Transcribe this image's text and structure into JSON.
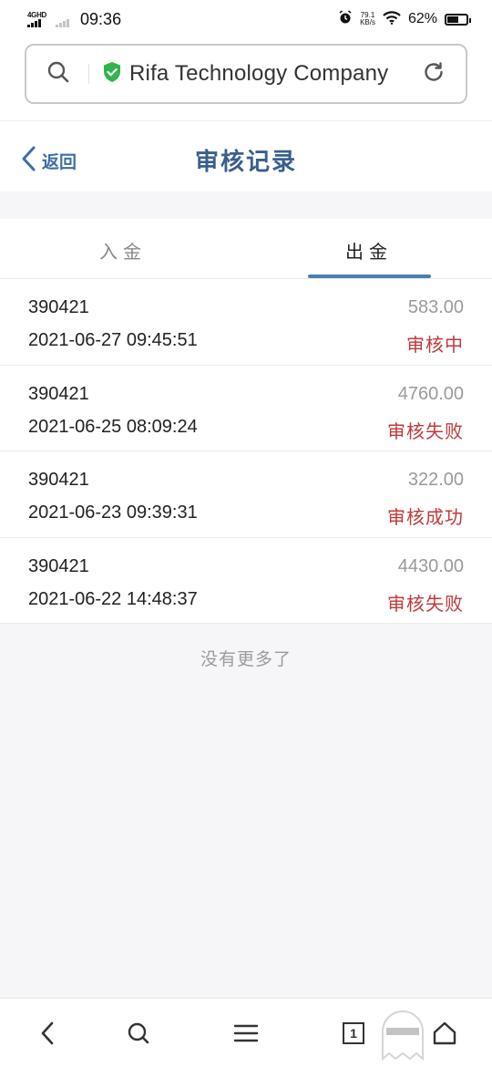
{
  "status_bar": {
    "network": "4GHD",
    "time": "09:36",
    "speed_value": "79.1",
    "speed_unit": "KB/s",
    "battery": "62%",
    "battery_level": 0.62,
    "icons": [
      "alarm-icon",
      "wifi-icon",
      "battery-icon"
    ]
  },
  "browser": {
    "url_text": "Rifa Technology Company",
    "icons": [
      "search-icon",
      "secure-shield-icon",
      "reload-icon"
    ],
    "secure_color": "#2fb54a"
  },
  "header": {
    "back_label": "返回",
    "title": "审核记录"
  },
  "tabs": [
    {
      "label": "入金",
      "active": false
    },
    {
      "label": "出金",
      "active": true
    }
  ],
  "records": [
    {
      "account": "390421",
      "amount": "583.00",
      "datetime": "2021-06-27 09:45:51",
      "status": "审核中"
    },
    {
      "account": "390421",
      "amount": "4760.00",
      "datetime": "2021-06-25 08:09:24",
      "status": "审核失败"
    },
    {
      "account": "390421",
      "amount": "322.00",
      "datetime": "2021-06-23 09:39:31",
      "status": "审核成功"
    },
    {
      "account": "390421",
      "amount": "4430.00",
      "datetime": "2021-06-22 14:48:37",
      "status": "审核失败"
    }
  ],
  "list_footer": "没有更多了",
  "bottom_nav": {
    "tab_count": "1",
    "icons": [
      "back-icon",
      "search-icon",
      "menu-icon",
      "tabs-icon",
      "home-icon"
    ]
  },
  "colors": {
    "accent": "#4a7fb5",
    "title": "#3a5f8f",
    "status_red": "#c0393b",
    "amount_gray": "#9a9a9a"
  }
}
